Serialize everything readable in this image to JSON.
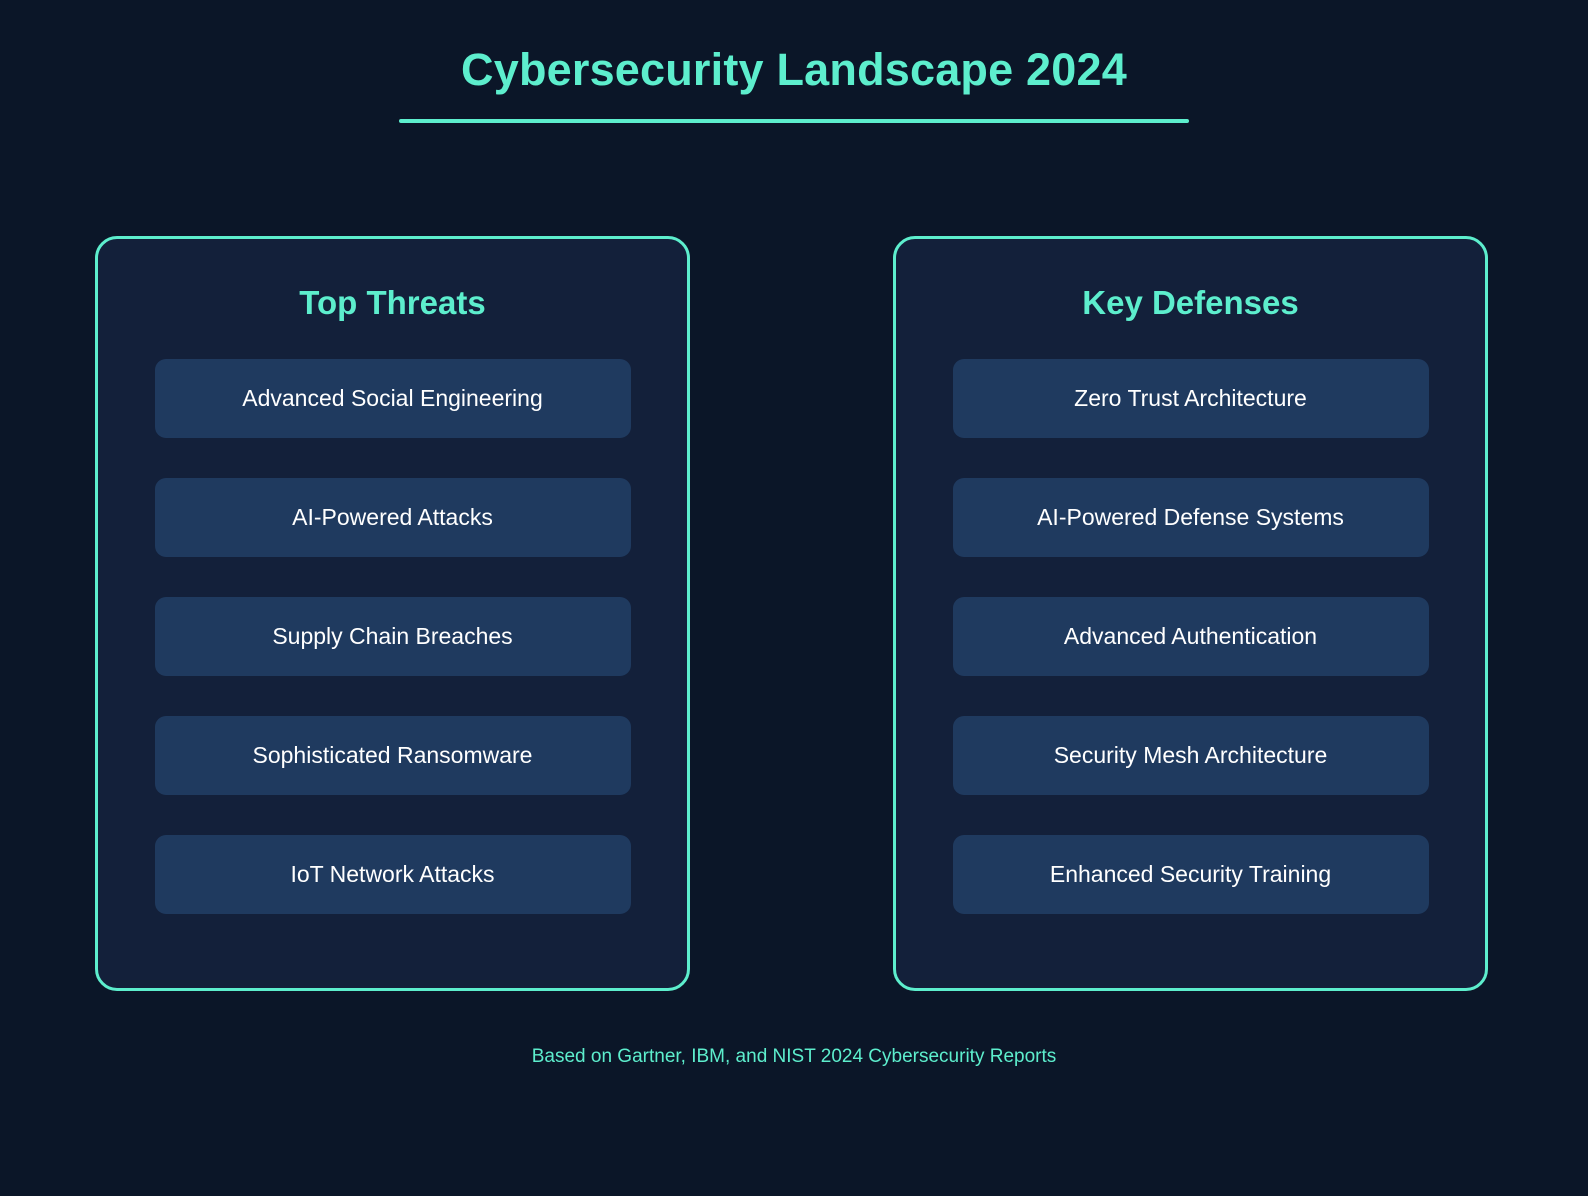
{
  "header": {
    "title": "Cybersecurity Landscape 2024"
  },
  "columns": [
    {
      "heading": "Top Threats",
      "items": [
        "Advanced Social Engineering",
        "AI-Powered Attacks",
        "Supply Chain Breaches",
        "Sophisticated Ransomware",
        "IoT Network Attacks"
      ]
    },
    {
      "heading": "Key Defenses",
      "items": [
        "Zero Trust Architecture",
        "AI-Powered Defense Systems",
        "Advanced Authentication",
        "Security Mesh Architecture",
        "Enhanced Security Training"
      ]
    }
  ],
  "footer": {
    "note": "Based on Gartner, IBM, and NIST 2024 Cybersecurity Reports"
  },
  "colors": {
    "page_background": "#0b1628",
    "card_background": "#13203a",
    "accent": "#5deecd",
    "item_background": "#1f3a5f",
    "item_text": "#ffffff"
  }
}
